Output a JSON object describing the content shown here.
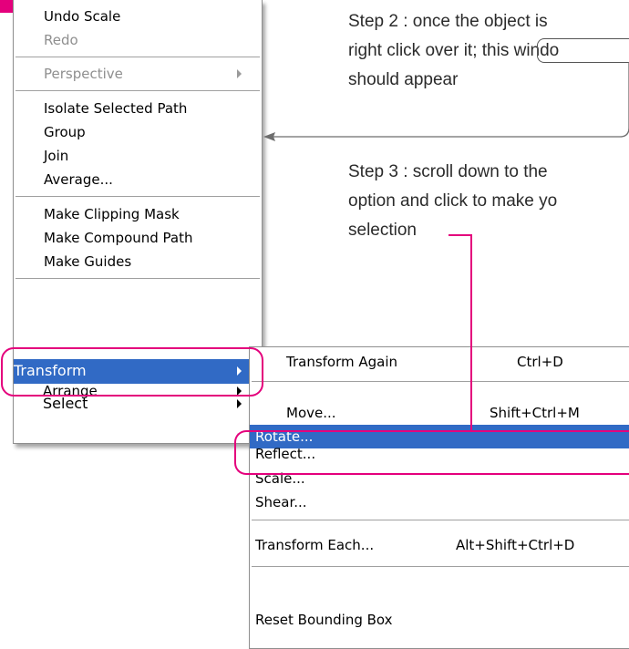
{
  "main_menu": {
    "items": [
      {
        "label": "Undo Scale",
        "disabled": false
      },
      {
        "label": "Redo",
        "disabled": true
      },
      {
        "label": "Perspective",
        "disabled": true,
        "submenu": true
      },
      {
        "label": "Isolate Selected Path",
        "disabled": false
      },
      {
        "label": "Group",
        "disabled": false
      },
      {
        "label": "Join",
        "disabled": false
      },
      {
        "label": "Average...",
        "disabled": false
      },
      {
        "label": "Make Clipping Mask",
        "disabled": false
      },
      {
        "label": "Make Compound Path",
        "disabled": false
      },
      {
        "label": "Make Guides",
        "disabled": false
      },
      {
        "label": "Transform",
        "highlighted": true,
        "submenu": true
      },
      {
        "label": "Arrange",
        "submenu": true
      },
      {
        "label": "Select",
        "submenu": true
      }
    ]
  },
  "transform_submenu": {
    "items": [
      {
        "label": "Transform Again",
        "shortcut": "Ctrl+D"
      },
      {
        "label": "Move...",
        "shortcut": "Shift+Ctrl+M"
      },
      {
        "label": "Rotate...",
        "shortcut": "",
        "highlighted": true
      },
      {
        "label": "Reflect..."
      },
      {
        "label": "Scale..."
      },
      {
        "label": "Shear..."
      },
      {
        "label": "Transform Each...",
        "shortcut": "Alt+Shift+Ctrl+D"
      },
      {
        "label": "Reset Bounding Box"
      }
    ]
  },
  "annotations": {
    "step2": {
      "line1": "Step 2 : once the object is",
      "line2_a": "right click over it; this ",
      "line2_b": "windo",
      "line3": "should appear"
    },
    "step3": {
      "line1": "Step 3 : scroll down to the",
      "line2": "option and click to make yo",
      "line3": "selection"
    }
  },
  "colors": {
    "highlight": "#316ac5",
    "annotation_pink": "#e4007c",
    "disabled_text": "#8f8f8f"
  }
}
